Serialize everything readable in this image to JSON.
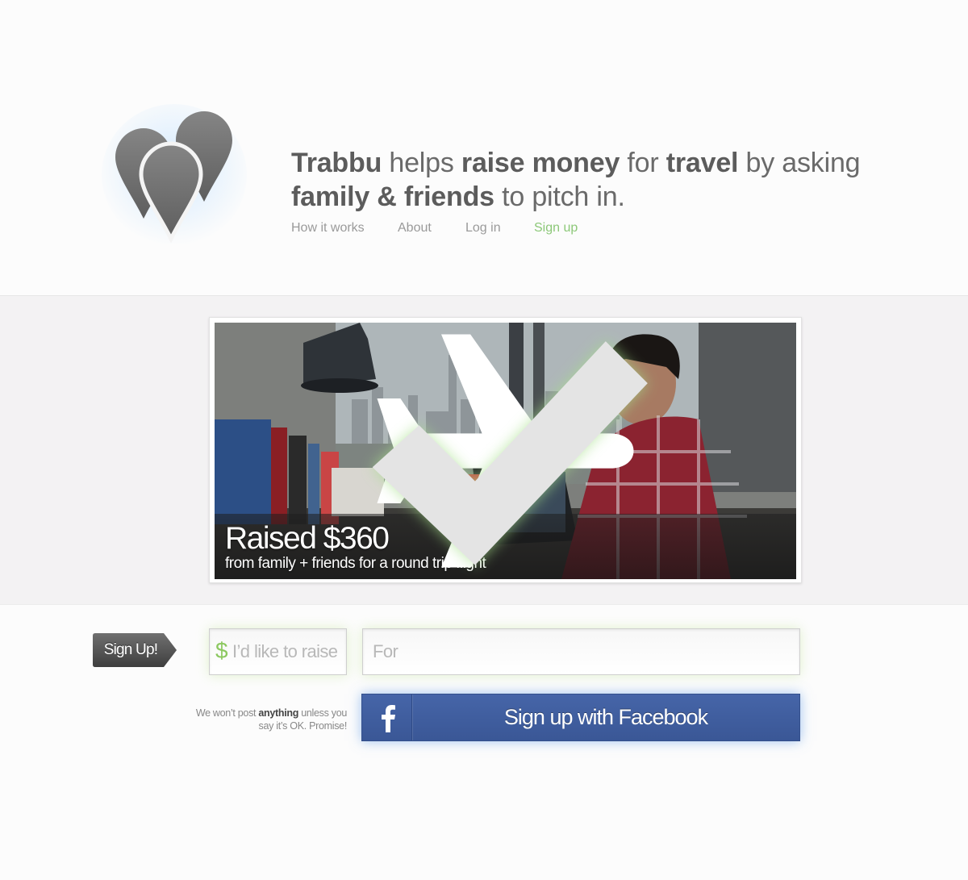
{
  "header": {
    "tagline": {
      "brand": "Trabbu",
      "t1": " helps ",
      "b1": "raise money",
      "t2": " for ",
      "b2": "travel",
      "t3": " by asking ",
      "b3": "family & friends",
      "t4": " to pitch in."
    },
    "nav": {
      "how_it_works": "How it works",
      "about": "About",
      "log_in": "Log in",
      "sign_up": "Sign up"
    }
  },
  "feature": {
    "headline": "Raised $360",
    "subline": "from family + friends for a round trip flight",
    "plane_icon": "airplane-icon",
    "check_icon": "checkmark-icon"
  },
  "signup": {
    "tag_label": "Sign Up!",
    "raise_currency": "$",
    "raise_placeholder": "I’d like to raise",
    "for_placeholder": "For",
    "privacy": {
      "t1": "We won’t post ",
      "b1": "anything",
      "t2": " unless you say it’s OK. Promise!"
    },
    "facebook_label": "Sign up with Facebook",
    "facebook_icon": "facebook-icon"
  },
  "colors": {
    "accent_green": "#8cc878",
    "facebook_blue": "#3b5998",
    "band_background": "#f3f2f3"
  }
}
